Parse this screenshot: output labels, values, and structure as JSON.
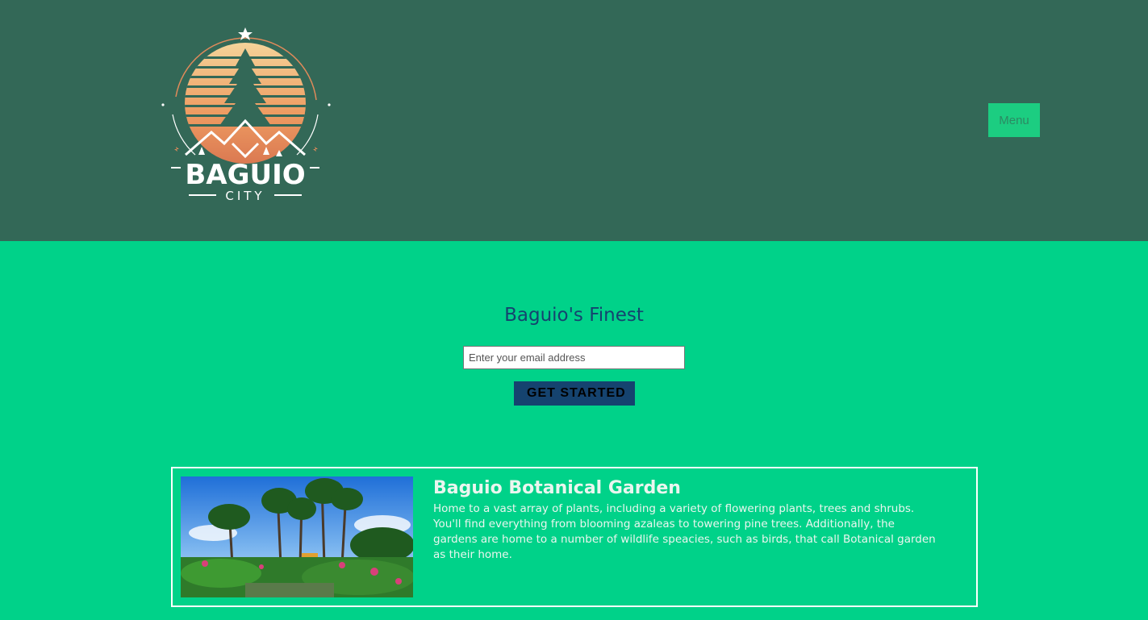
{
  "header": {
    "logo": {
      "brand_text": "BAGUIO",
      "sub_text": "CITY",
      "icon": "pine-tree-mountain-logo"
    },
    "menu_label": "Menu"
  },
  "hero": {
    "title": "Baguio's Finest",
    "email_placeholder": "Enter your email address",
    "cta_label": "GET STARTED"
  },
  "cards": [
    {
      "title": "Baguio Botanical Garden",
      "description": "Home to a vast array of plants, including a variety of flowering plants, trees and shrubs. You'll find everything from blooming azaleas to towering pine trees. Additionally, the gardens are home to a number of wildlife speacies, such as birds, that call Botanical garden as their home.",
      "image": "botanical-garden-photo"
    }
  ],
  "colors": {
    "header_bg": "#336857",
    "page_bg": "#00d289",
    "accent": "#15436f",
    "menu_bg": "#1ccd81"
  }
}
